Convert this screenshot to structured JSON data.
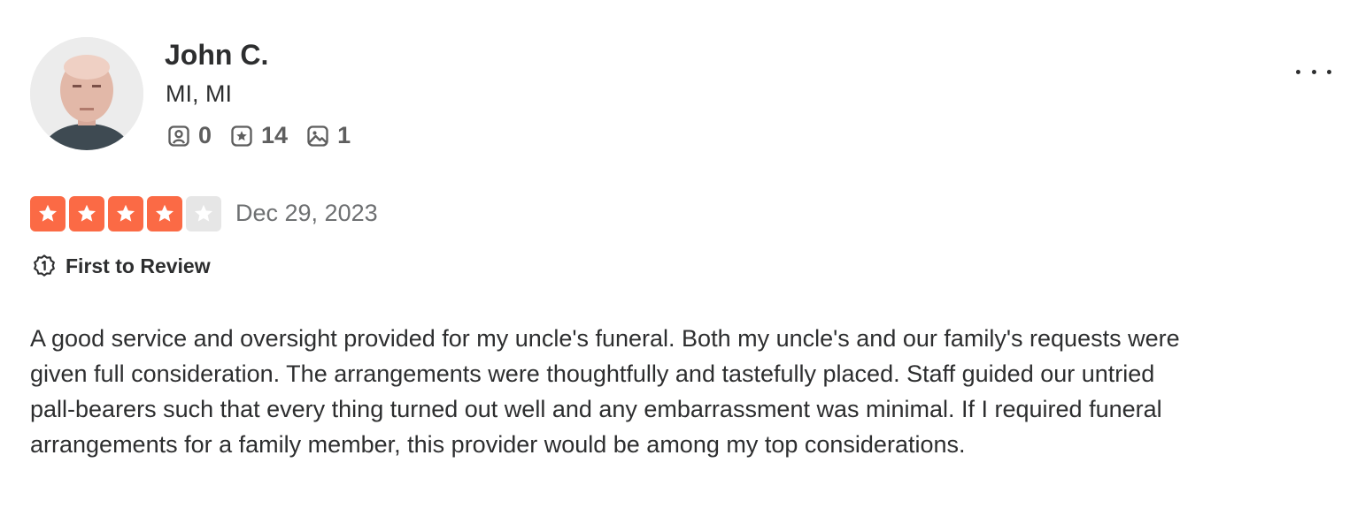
{
  "user": {
    "name": "John C.",
    "location": "MI, MI",
    "stats": [
      {
        "icon": "friends-icon",
        "value": "0"
      },
      {
        "icon": "review-star-icon",
        "value": "14"
      },
      {
        "icon": "photo-icon",
        "value": "1"
      }
    ]
  },
  "review": {
    "rating": 4,
    "max_rating": 5,
    "date": "Dec 29, 2023",
    "badge": {
      "icon": "first-to-review-icon",
      "label": "First to Review"
    },
    "text": "A good service and oversight provided for my uncle's funeral. Both my uncle's and our family's requests were given full consideration. The arrangements were thoughtfully and tastefully placed. Staff guided our untried pall-bearers such that every thing turned out well and any embarrassment was minimal. If I required funeral arrangements for a family member, this provider would be among my top considerations."
  },
  "menu": {
    "icon": "more-options-icon"
  },
  "colors": {
    "star_filled": "#fb6a45",
    "star_empty": "#e6e6e6",
    "text": "#2d2e2f",
    "muted": "#6e7072"
  }
}
